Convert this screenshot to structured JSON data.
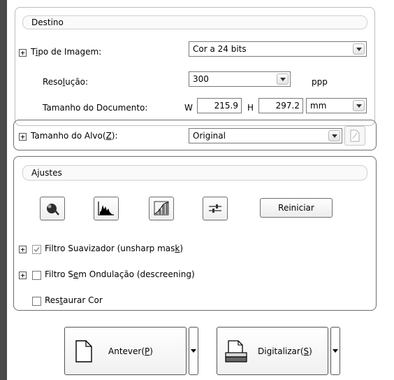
{
  "destino": {
    "title": "Destino",
    "tipo_label_pre": "T",
    "tipo_label_ul": "i",
    "tipo_label_post": "po de Imagem:",
    "tipo_value": "Cor a 24 bits",
    "resolucao_label_pre": "Reso",
    "resolucao_label_ul": "l",
    "resolucao_label_post": "ução:",
    "resolucao_value": "300",
    "resolucao_unit": "ppp",
    "tamanho_label": "Tamanho do Documento:",
    "w_label": "W",
    "w_value": "215.9",
    "h_label": "H",
    "h_value": "297.2",
    "unit_value": "mm"
  },
  "alvo": {
    "label_pre": "Tamanho do Alvo(",
    "label_ul": "Z",
    "label_post": "):",
    "value": "Original"
  },
  "ajustes": {
    "title": "Ajustes",
    "reset_label": "Reiniciar",
    "unsharp_pre": "Filtro Suavizador (unsharp mas",
    "unsharp_ul": "k",
    "unsharp_post": ")",
    "unsharp_checked": true,
    "descreen_pre": "Filtro S",
    "descreen_ul": "e",
    "descreen_post": "m Ondulação (descreening)",
    "restore_pre": "Res",
    "restore_ul": "t",
    "restore_post": "aurar Cor"
  },
  "footer": {
    "preview_pre": "Antever(",
    "preview_ul": "P",
    "preview_post": ")",
    "scan_pre": "Digitalizar(",
    "scan_ul": "S",
    "scan_post": ")"
  },
  "icons": [
    "expand-icon",
    "auto-exposure-icon",
    "histogram-icon",
    "tone-curve-icon",
    "image-adjustment-icon",
    "document-icon",
    "scanner-icon",
    "dropdown-arrow-icon"
  ]
}
